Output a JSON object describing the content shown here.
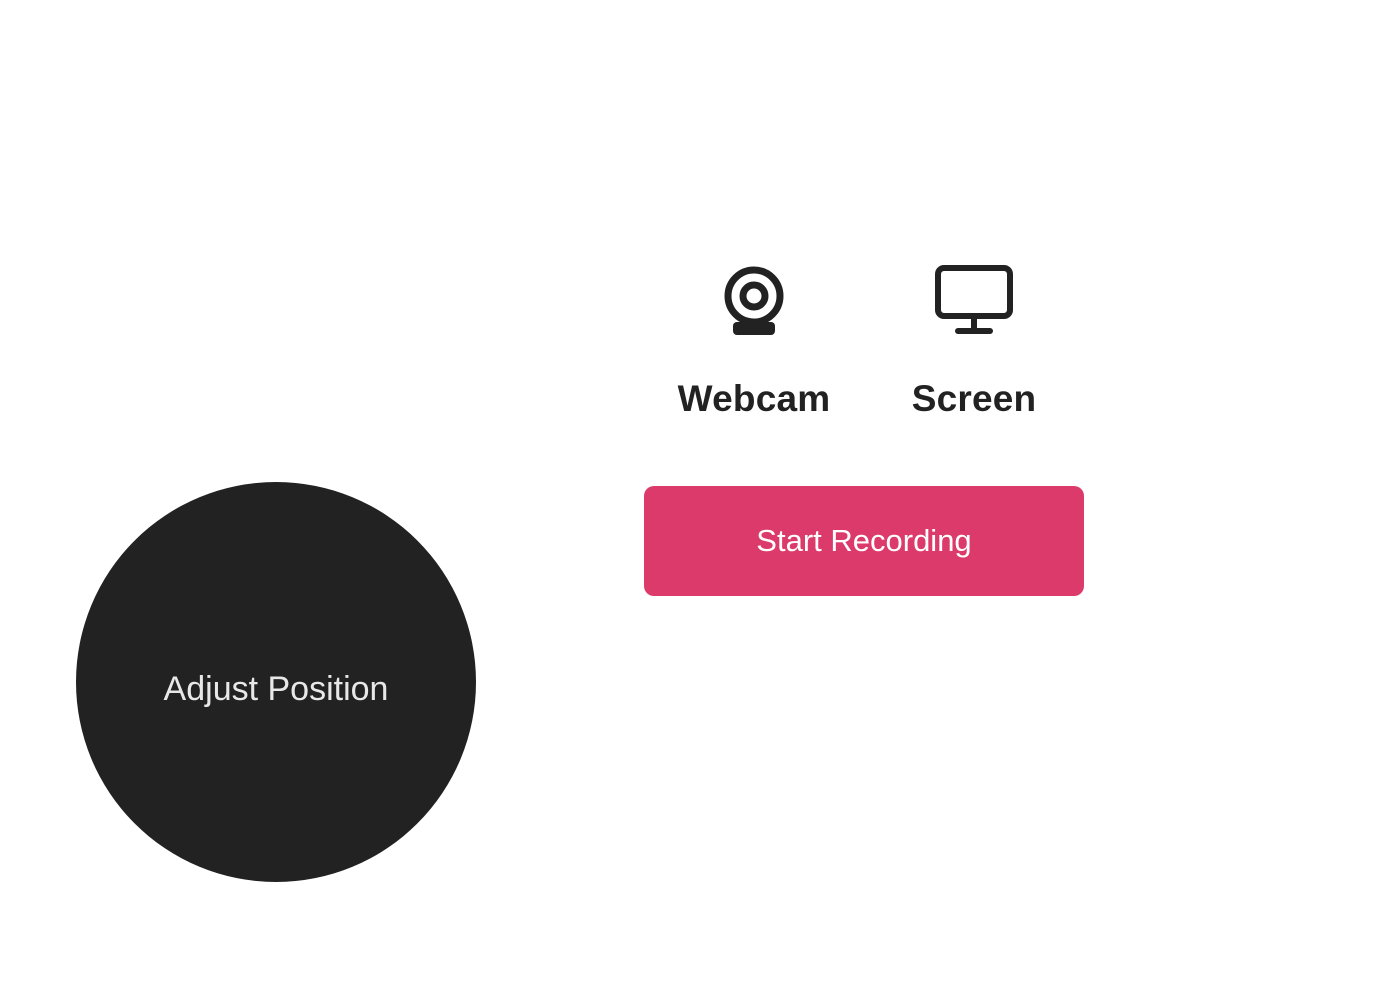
{
  "sources": {
    "webcam": {
      "label": "Webcam",
      "icon": "webcam-icon"
    },
    "screen": {
      "label": "Screen",
      "icon": "monitor-icon"
    }
  },
  "record_button": {
    "label": "Start Recording",
    "color": "#db3a6a"
  },
  "camera_bubble": {
    "label": "Adjust Position",
    "color": "#222222"
  }
}
